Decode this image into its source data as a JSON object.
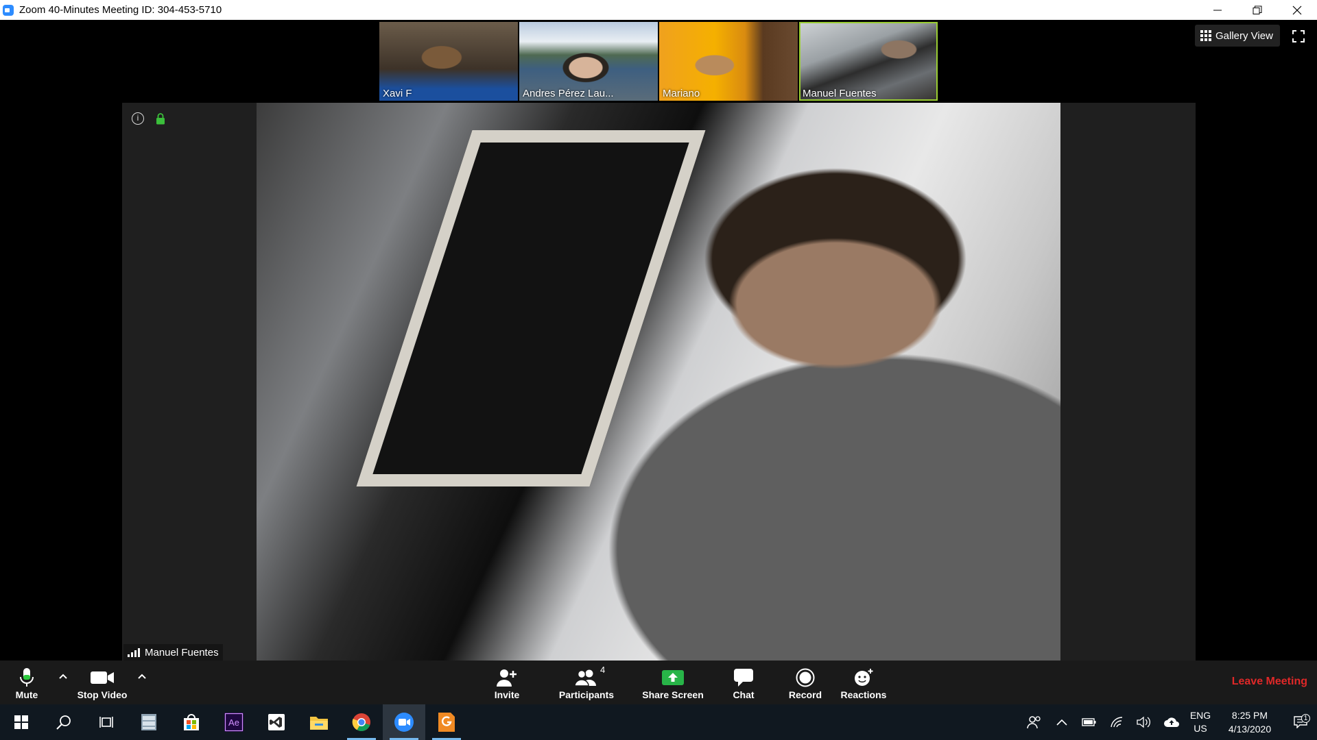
{
  "window": {
    "title": "Zoom 40-Minutes Meeting ID: 304-453-5710",
    "controls": [
      "minimize-icon",
      "restore-icon",
      "close-icon"
    ]
  },
  "header": {
    "gallery_view_label": "Gallery View"
  },
  "participants_strip": [
    {
      "name": "Xavi F",
      "active": false
    },
    {
      "name": "Andres Pérez Lau...",
      "active": false
    },
    {
      "name": "Mariano",
      "active": false
    },
    {
      "name": "Manuel Fuentes",
      "active": true
    }
  ],
  "active_speaker": {
    "name": "Manuel Fuentes"
  },
  "toolbar": {
    "mute_label": "Mute",
    "stop_video_label": "Stop Video",
    "invite_label": "Invite",
    "participants_label": "Participants",
    "participants_count": "4",
    "share_screen_label": "Share Screen",
    "chat_label": "Chat",
    "record_label": "Record",
    "reactions_label": "Reactions",
    "leave_label": "Leave Meeting",
    "share_color": "#28b448",
    "leave_color": "#e02828"
  },
  "taskbar": {
    "apps": [
      "windows-start-icon",
      "search-icon",
      "task-view-icon",
      "file-cabinet-icon",
      "store-icon",
      "after-effects-icon",
      "visual-studio-icon",
      "file-explorer-icon",
      "chrome-icon",
      "zoom-icon",
      "pdf-app-icon"
    ],
    "lang_line1": "ENG",
    "lang_line2": "US",
    "time": "8:25 PM",
    "date": "4/13/2020",
    "notification_count": "1"
  }
}
